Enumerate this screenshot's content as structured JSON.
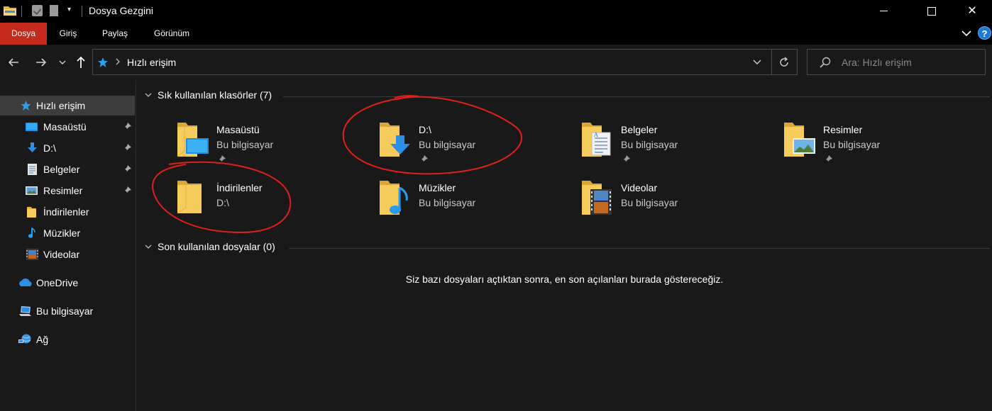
{
  "window": {
    "title": "Dosya Gezgini",
    "controls": {
      "minimize": "minimize-icon",
      "maximize": "maximize-icon",
      "close": "✕"
    }
  },
  "quick_access_toolbar": {
    "dropdown": "▾",
    "icons": [
      "folder-icon",
      "properties-icon",
      "new-folder-icon",
      "qat-dropdown-icon"
    ]
  },
  "ribbon": {
    "tabs": [
      {
        "label": "Dosya",
        "active": true,
        "color": "#c42b1c"
      },
      {
        "label": "Giriş"
      },
      {
        "label": "Paylaş"
      },
      {
        "label": "Görünüm"
      }
    ],
    "help": "?"
  },
  "address": {
    "path": "Hızlı erişim",
    "icons": [
      "back-arrow-icon",
      "forward-arrow-icon",
      "recent-dropdown-icon",
      "up-arrow-icon",
      "star-icon",
      "chevron-right-icon",
      "chevron-down-icon",
      "refresh-icon"
    ]
  },
  "search": {
    "placeholder": "Ara: Hızlı erişim",
    "value": ""
  },
  "sidebar": {
    "items": [
      {
        "label": "Hızlı erişim",
        "icon": "star-icon",
        "selected": true
      },
      {
        "label": "Masaüstü",
        "icon": "desktop-icon",
        "pinned": true
      },
      {
        "label": "D:\\",
        "icon": "download-arrow-icon",
        "pinned": true
      },
      {
        "label": "Belgeler",
        "icon": "documents-icon",
        "pinned": true
      },
      {
        "label": "Resimler",
        "icon": "pictures-icon",
        "pinned": true
      },
      {
        "label": "İndirilenler",
        "icon": "folder-icon"
      },
      {
        "label": "Müzikler",
        "icon": "music-note-icon"
      },
      {
        "label": "Videolar",
        "icon": "film-icon"
      },
      {
        "label": "OneDrive",
        "icon": "cloud-icon"
      },
      {
        "label": "Bu bilgisayar",
        "icon": "computer-icon"
      },
      {
        "label": "Ağ",
        "icon": "network-icon"
      }
    ]
  },
  "frequent": {
    "header": "Sık kullanılan klasörler (7)",
    "folders": [
      {
        "name": "Masaüstü",
        "sub": "Bu bilgisayar",
        "pinned": true,
        "badge": "desktop"
      },
      {
        "name": "D:\\",
        "sub": "Bu bilgisayar",
        "pinned": true,
        "badge": "download"
      },
      {
        "name": "Belgeler",
        "sub": "Bu bilgisayar",
        "pinned": true,
        "badge": "documents"
      },
      {
        "name": "Resimler",
        "sub": "Bu bilgisayar",
        "pinned": true,
        "badge": "pictures"
      },
      {
        "name": "İndirilenler",
        "sub": "D:\\",
        "pinned": false,
        "badge": "none"
      },
      {
        "name": "Müzikler",
        "sub": "Bu bilgisayar",
        "pinned": false,
        "badge": "music"
      },
      {
        "name": "Videolar",
        "sub": "Bu bilgisayar",
        "pinned": false,
        "badge": "video"
      }
    ]
  },
  "recent": {
    "header": "Son kullanılan dosyalar (0)",
    "empty_message": "Siz bazı dosyaları açtıktan sonra, en son açılanları burada göstereceğiz."
  },
  "colors": {
    "background": "#191919",
    "chrome": "#000000",
    "accent_file_tab": "#c42b1c",
    "selection": "#3d3d3d",
    "annotation": "#e0201a",
    "folder_yellow": "#f6cd5c",
    "icon_blue": "#1f8fe0"
  }
}
